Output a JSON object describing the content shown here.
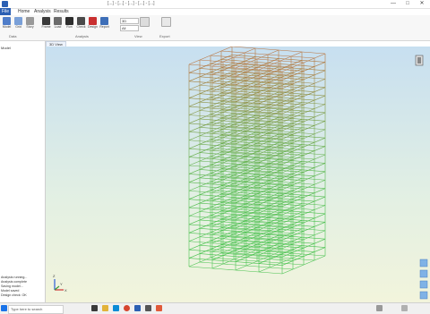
{
  "window": {
    "title": "[...] - [...] - [...] - [...] - [...]",
    "min_icon": "—",
    "max_icon": "□",
    "close_icon": "✕"
  },
  "ribbon": {
    "tabs": [
      "File",
      "Home",
      "Analysis",
      "Results"
    ],
    "groups": [
      "Data",
      "Analysis",
      "View",
      "Export"
    ],
    "buttons": [
      "Model",
      "Grid",
      "Story",
      "Frame",
      "Load",
      "Run",
      "Check",
      "Design",
      "Report"
    ],
    "combo_values": [
      "3D",
      "All"
    ]
  },
  "sidebar": {
    "tree": [
      "Model",
      "Stories",
      "Grids",
      "Frames"
    ],
    "log": [
      "Analysis running...",
      "Analysis complete",
      "Saving model...",
      "Model saved",
      "Design check: OK"
    ]
  },
  "viewport": {
    "tab_label": "3D View",
    "axis_labels": {
      "x": "X",
      "y": "Y",
      "z": "Z"
    }
  },
  "taskbar": {
    "search_placeholder": "Type here to search",
    "icons": [
      "search-icon",
      "task-view-icon",
      "file-explorer-icon",
      "edge-icon",
      "chrome-icon",
      "store-icon",
      "mail-icon",
      "app-icon"
    ]
  },
  "colors": {
    "frame_low": "#49c24f",
    "frame_high": "#e05a3a",
    "accent": "#2b5fb3"
  }
}
